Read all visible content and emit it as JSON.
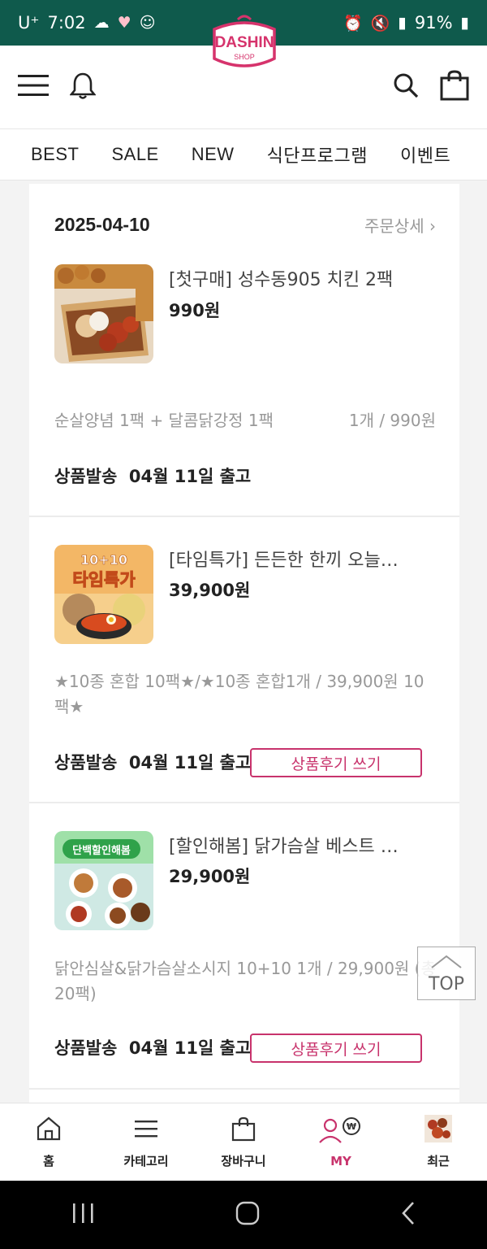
{
  "status": {
    "carrier": "U⁺",
    "time": "7:02",
    "battery": "91%"
  },
  "header": {
    "logo_text": "DASHIN",
    "logo_sub": "SHOP",
    "brand_color": "#d6336c"
  },
  "tabs": [
    "BEST",
    "SALE",
    "NEW",
    "식단프로그램",
    "이벤트"
  ],
  "order": {
    "date": "2025-04-10",
    "detail_link": "주문상세 ›"
  },
  "items": [
    {
      "name": "[첫구매] 성수동905 치킨 2팩",
      "price": "990원",
      "option": "순살양념 1팩 + 달콤닭강정 1팩",
      "qty_price": "1개 / 990원",
      "ship_label": "상품발송",
      "ship_date": "04월 11일 출고",
      "review_label": ""
    },
    {
      "name": "[타임특가] 든든한 한끼 오늘…",
      "price": "39,900원",
      "option": "★10종 혼합 10팩★/★10종 혼합1개 / 39,900원 10팩★",
      "qty_price": "",
      "ship_label": "상품발송",
      "ship_date": "04월 11일 출고",
      "review_label": "상품후기 쓰기",
      "badge_top": "10+10",
      "badge_main": "타임특가"
    },
    {
      "name": "[할인해봄] 닭가슴살 베스트 …",
      "price": "29,900원",
      "option": "닭안심살&닭가슴살소시지 10+10 1개 / 29,900원 (총20팩)",
      "qty_price": "",
      "ship_label": "상품발송",
      "ship_date": "04월 11일 출고",
      "review_label": "상품후기 쓰기",
      "badge_main": "단백할인해봄"
    }
  ],
  "top_button": "TOP",
  "bottom_nav": [
    {
      "label": "홈",
      "icon": "home-icon"
    },
    {
      "label": "카테고리",
      "icon": "menu-icon"
    },
    {
      "label": "장바구니",
      "icon": "bag-icon"
    },
    {
      "label": "MY",
      "icon": "user-won-icon",
      "active": true
    },
    {
      "label": "최근",
      "icon": "recent-thumb"
    }
  ]
}
